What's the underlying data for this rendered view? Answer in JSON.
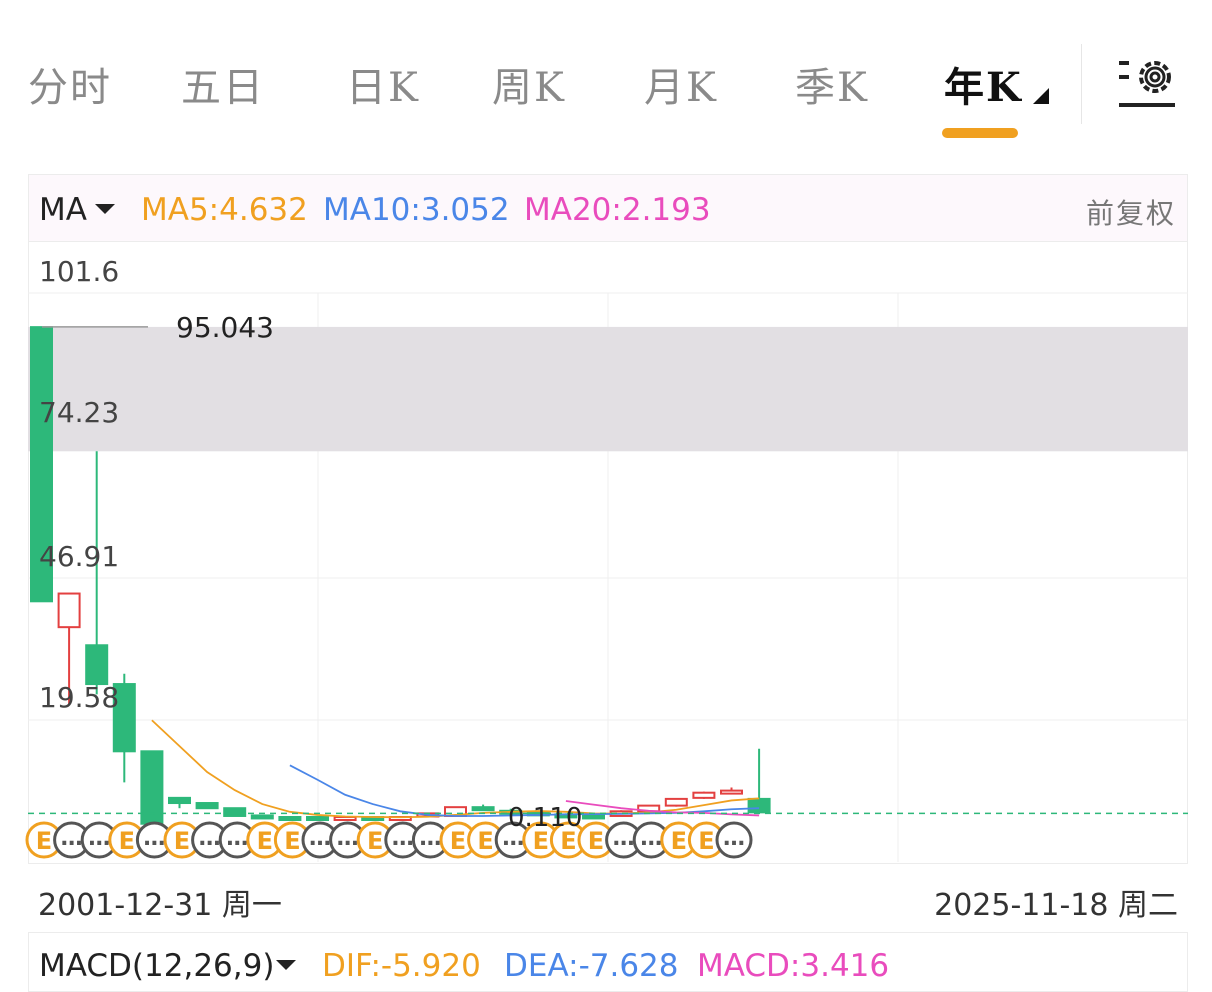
{
  "tabs": [
    {
      "label": "分时"
    },
    {
      "label": "五日"
    },
    {
      "label": "日K"
    },
    {
      "label": "周K"
    },
    {
      "label": "月K"
    },
    {
      "label": "季K"
    },
    {
      "label": "年K",
      "active": true
    }
  ],
  "settings_icon": "settings-gear-icon",
  "legend": {
    "indicator": "MA",
    "ma5": "MA5:4.632",
    "ma10": "MA10:3.052",
    "ma20": "MA20:2.193",
    "adjust": "前复权"
  },
  "colors": {
    "up": "#e34040",
    "down": "#2db87a",
    "ma5": "#f0a020",
    "ma10": "#4a86e8",
    "ma20": "#e94cbd",
    "accent": "#f0a020"
  },
  "chart_data": {
    "type": "candlestick",
    "y_tick_labels": [
      "101.6",
      "74.23",
      "46.91",
      "19.58"
    ],
    "ylim": [
      -8.4,
      101.6
    ],
    "max_marker_label": "95.043",
    "min_marker_label": "0.110",
    "highlight_band": [
      71.0,
      95.043
    ],
    "reference_line": 1.0,
    "candles": [
      {
        "open": 95.0,
        "close": 42.0,
        "high": 95.043,
        "low": 42.0
      },
      {
        "open": 37.0,
        "close": 43.5,
        "high": 43.5,
        "low": 22.0
      },
      {
        "open": 33.5,
        "close": 26.0,
        "high": 71.0,
        "low": 24.0
      },
      {
        "open": 26.0,
        "close": 13.0,
        "high": 28.0,
        "low": 7.0
      },
      {
        "open": 13.0,
        "close": -1.0,
        "high": 13.0,
        "low": -1.0
      },
      {
        "open": 4.0,
        "close": 3.0,
        "high": 4.0,
        "low": 2.0
      },
      {
        "open": 3.0,
        "close": 2.0,
        "high": 3.0,
        "low": 2.0
      },
      {
        "open": 2.0,
        "close": 0.5,
        "high": 2.0,
        "low": 0.4
      },
      {
        "open": 0.6,
        "close": 0.2,
        "high": 0.6,
        "low": 0.1
      },
      {
        "open": 0.3,
        "close": 0.12,
        "high": 0.3,
        "low": 0.11
      },
      {
        "open": 0.3,
        "close": 0.2,
        "high": 0.4,
        "low": 0.11
      },
      {
        "open": 0.3,
        "close": 0.3,
        "high": 0.5,
        "low": 0.2
      },
      {
        "open": 0.3,
        "close": 0.2,
        "high": 0.4,
        "low": 0.1
      },
      {
        "open": 0.15,
        "close": 0.3,
        "high": 0.35,
        "low": 0.11
      },
      {
        "open": 0.4,
        "close": 1.0,
        "high": 1.0,
        "low": 0.2
      },
      {
        "open": 0.5,
        "close": 2.2,
        "high": 2.2,
        "low": 0.4
      },
      {
        "open": 2.2,
        "close": 1.8,
        "high": 2.7,
        "low": 1.5
      },
      {
        "open": 1.5,
        "close": 1.2,
        "high": 1.9,
        "low": 1.0
      },
      {
        "open": 1.2,
        "close": 0.8,
        "high": 1.3,
        "low": 0.7
      },
      {
        "open": 0.8,
        "close": 0.6,
        "high": 1.0,
        "low": 0.5
      },
      {
        "open": 0.6,
        "close": 0.5,
        "high": 0.8,
        "low": 0.4
      },
      {
        "open": 0.5,
        "close": 1.4,
        "high": 1.6,
        "low": 0.4
      },
      {
        "open": 1.4,
        "close": 2.5,
        "high": 2.6,
        "low": 1.2
      },
      {
        "open": 2.5,
        "close": 3.8,
        "high": 3.9,
        "low": 2.3
      },
      {
        "open": 4.0,
        "close": 5.0,
        "high": 5.2,
        "low": 3.8
      },
      {
        "open": 5.0,
        "close": 5.4,
        "high": 6.0,
        "low": 4.8
      },
      {
        "open": 3.8,
        "close": 1.2,
        "high": 13.5,
        "low": 1.0
      }
    ],
    "ma5": [
      null,
      null,
      null,
      null,
      19.0,
      14.0,
      9.0,
      5.5,
      2.8,
      1.3,
      0.7,
      0.4,
      0.3,
      0.25,
      0.35,
      0.7,
      1.1,
      1.3,
      1.45,
      1.3,
      1.0,
      0.95,
      1.2,
      1.7,
      2.6,
      3.5,
      3.9
    ],
    "ma10": [
      null,
      null,
      null,
      null,
      null,
      null,
      null,
      null,
      null,
      10.3,
      7.5,
      4.6,
      2.8,
      1.4,
      0.7,
      0.5,
      0.5,
      0.6,
      0.7,
      0.8,
      0.85,
      0.9,
      1.0,
      1.1,
      1.4,
      1.8,
      2.0
    ],
    "ma20": [
      null,
      null,
      null,
      null,
      null,
      null,
      null,
      null,
      null,
      null,
      null,
      null,
      null,
      null,
      null,
      null,
      null,
      null,
      null,
      3.4,
      2.7,
      2.0,
      1.5,
      1.2,
      1.1,
      0.8,
      0.6
    ],
    "events": [
      "E",
      "…",
      "…",
      "E",
      "…",
      "E",
      "…",
      "…",
      "E",
      "E",
      "…",
      "…",
      "E",
      "…",
      "…",
      "E",
      "E",
      "…",
      "E",
      "E",
      "E",
      "…",
      "…",
      "E",
      "E",
      "…"
    ],
    "start_date": "2001-12-31 周一",
    "end_date": "2025-11-18 周二"
  },
  "macd": {
    "indicator": "MACD(12,26,9)",
    "dif": "DIF:-5.920",
    "dea": "DEA:-7.628",
    "macd": "MACD:3.416"
  }
}
